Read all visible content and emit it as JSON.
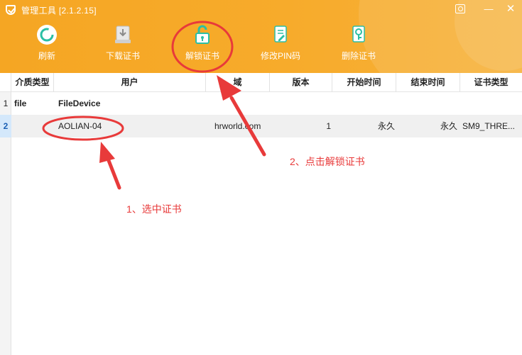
{
  "window": {
    "title": "管理工具 [2.1.2.15]",
    "controls": [
      "skin",
      "minimize",
      "close"
    ]
  },
  "toolbar": {
    "items": [
      {
        "label": "刷新",
        "icon": "refresh-icon"
      },
      {
        "label": "下载证书",
        "icon": "download-cert-icon"
      },
      {
        "label": "解锁证书",
        "icon": "unlock-icon"
      },
      {
        "label": "修改PIN码",
        "icon": "edit-pin-icon"
      },
      {
        "label": "删除证书",
        "icon": "delete-cert-icon"
      }
    ]
  },
  "table": {
    "columns": [
      "介质类型",
      "用户",
      "域",
      "版本",
      "开始时间",
      "结束时间",
      "证书类型"
    ],
    "rows": [
      {
        "num": "1",
        "media_type": "file",
        "user": "FileDevice"
      },
      {
        "num": "2",
        "user": "AOLIAN-04",
        "domain": "hrworld.com",
        "version": "1",
        "start": "永久",
        "end": "永久",
        "cert_type": "SM9_THRE..."
      }
    ]
  },
  "annotations": {
    "step1": "1、选中证书",
    "step2": "2、点击解锁证书"
  },
  "colors": {
    "toolbar_bg": "#f5a623",
    "annotation": "#e83a3a",
    "selected_row_number": "#d4e8fb"
  }
}
